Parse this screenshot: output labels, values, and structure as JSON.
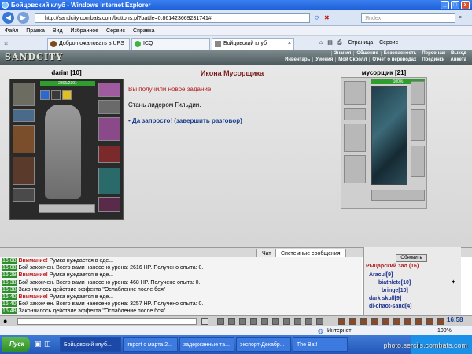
{
  "window": {
    "title": "Бойцовский клуб - Windows Internet Explorer"
  },
  "addressbar": {
    "url": "http://sandcity.combats.com/buttons.pl?battle=0.861423669231741#",
    "search_placeholder": "Яndex"
  },
  "menu": {
    "items": [
      "Файл",
      "Правка",
      "Вид",
      "Избранное",
      "Сервис",
      "Справка"
    ]
  },
  "tabs": [
    {
      "label": "Добро пожаловать в UPS"
    },
    {
      "label": "ICQ"
    },
    {
      "label": "Бойцовский клуб"
    }
  ],
  "browser_tools": [
    "Страница",
    "Сервис"
  ],
  "game": {
    "logo": "SANDCITY",
    "nav_top": [
      "Знания",
      "Общение",
      "Безопасность",
      "Персонаж",
      "Выход"
    ],
    "nav_bottom": [
      "Инвентарь",
      "Умения",
      "Мой Скролл",
      "Отчет о переводах",
      "Поединки",
      "Анкета"
    ]
  },
  "player": {
    "name": "darim",
    "level": "[10]",
    "hp": "2301/2301"
  },
  "quest": {
    "title": "Икона Мусорщика",
    "line1": "Вы получили новое задание.",
    "line2": "Стань лидером Гильдии.",
    "line3": "• Да запросто! (завершить разговор)"
  },
  "enemy": {
    "name": "мусорщик",
    "level": "[21]",
    "hp": "100%"
  },
  "chat": {
    "tabs": [
      "Чат",
      "Системные сообщения"
    ],
    "lines": [
      {
        "time": "16:08",
        "warn": "Внимание!",
        "text": " Румка нуждается в еде..."
      },
      {
        "time": "16:08",
        "warn": "",
        "text": "Бой закончен. Всего вами нанесено урона: 2616 HP. Получено опыта: 0."
      },
      {
        "time": "16:29",
        "warn": "Внимание!",
        "text": " Румка нуждается в еде..."
      },
      {
        "time": "16:38",
        "warn": "",
        "text": "Бой закончен. Всего вами нанесено урона: 468 HP. Получено опыта: 0."
      },
      {
        "time": "16:38",
        "warn": "",
        "text": "Закончилось действие эффекта \"Ослабление после боя\""
      },
      {
        "time": "16:40",
        "warn": "Внимание!",
        "text": " Румка нуждается в еде..."
      },
      {
        "time": "16:40",
        "warn": "",
        "text": "Бой закончен. Всего вами нанесено урона: 3257 HP. Получено опыта: 0."
      },
      {
        "time": "16:48",
        "warn": "",
        "text": "Закончилось действие эффекта \"Ослабление после боя\""
      }
    ]
  },
  "room": {
    "refresh": "Обновить",
    "title": "Рыцарский зал (16)",
    "users": [
      "Aracul[9]",
      "biathlete[10]",
      "bringe[10]",
      "dark skull[9]",
      "dl-chaot-sand[4]"
    ],
    "clock": "16:58"
  },
  "status": {
    "text": "Интернет",
    "zoom": "100%"
  },
  "taskbar": {
    "start": "Пуск",
    "tasks": [
      "Бойцовский клуб...",
      "import с марта 2...",
      "задержанные та...",
      "экспорт-Декабр...",
      "The Bat!"
    ],
    "watermark": "photo.sercils.combats.com"
  }
}
